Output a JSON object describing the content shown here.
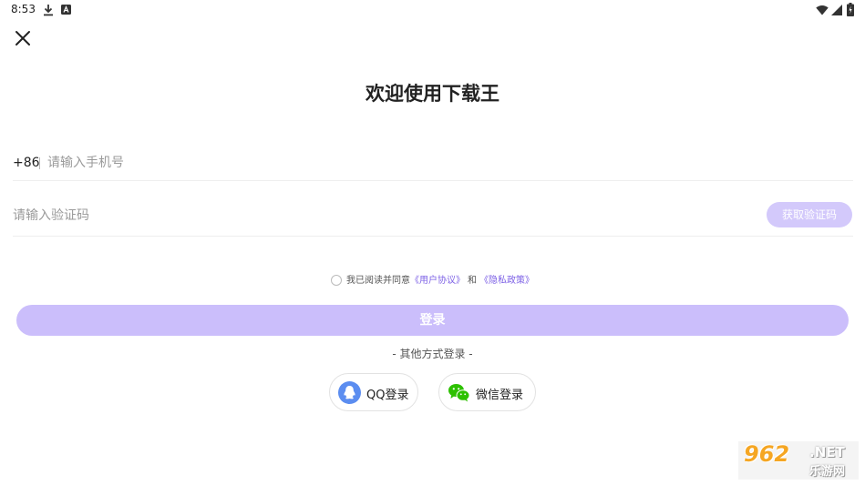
{
  "status_bar": {
    "time": "8:53",
    "icons": [
      "download-icon",
      "app-notification-icon",
      "wifi-icon",
      "signal-icon",
      "battery-icon"
    ]
  },
  "header": {
    "close_icon": "close-icon",
    "title": "欢迎使用下载王"
  },
  "form": {
    "country_code": "+86",
    "phone_placeholder": "请输入手机号",
    "phone_value": "",
    "code_placeholder": "请输入验证码",
    "code_value": "",
    "get_code_label": "获取验证码"
  },
  "agreement": {
    "checked": false,
    "prefix": "我已阅读并同意",
    "user_agreement": "《用户协议》",
    "conjunction": "和",
    "privacy_policy": "《隐私政策》"
  },
  "login": {
    "label": "登录"
  },
  "other_login": {
    "label": "- 其他方式登录 -",
    "qq_label": "QQ登录",
    "wechat_label": "微信登录"
  },
  "watermark": {
    "number": "962",
    "domain": ".NET",
    "site_name": "乐游网"
  },
  "colors": {
    "accent": "#7e62e6",
    "button_disabled": "#cbbefb",
    "qq_blue": "#5b8df0",
    "wechat_green": "#2dc100"
  }
}
